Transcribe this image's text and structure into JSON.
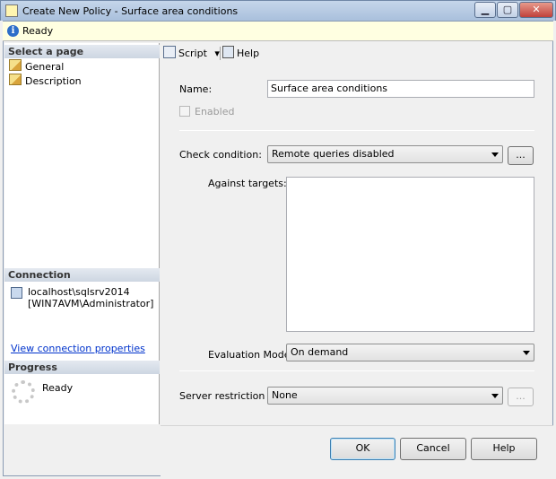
{
  "window": {
    "title": "Create New Policy - Surface area conditions",
    "minimize_glyph": "▁",
    "maximize_glyph": "▢",
    "close_glyph": "✕"
  },
  "status": {
    "text": "Ready",
    "icon": "info-icon",
    "icon_glyph": "i"
  },
  "sidebar": {
    "select_page_header": "Select a page",
    "pages": [
      {
        "label": "General",
        "icon": "page-icon"
      },
      {
        "label": "Description",
        "icon": "page-icon"
      }
    ],
    "connection_header": "Connection",
    "server": "localhost\\sqlsrv2014",
    "user": "[WIN7AVM\\Administrator]",
    "view_connection_link": "View connection properties",
    "progress_header": "Progress",
    "progress_status": "Ready"
  },
  "toolbar": {
    "script_label": "Script",
    "script_dropdown_glyph": "▾",
    "help_label": "Help"
  },
  "form": {
    "name_label": "Name:",
    "name_value": "Surface area conditions",
    "enabled_label": "Enabled",
    "check_condition_label": "Check condition:",
    "check_condition_value": "Remote queries disabled",
    "ellipsis_label": "...",
    "against_targets_label": "Against targets:",
    "evaluation_mode_label": "Evaluation Mode:",
    "evaluation_mode_value": "On demand",
    "server_restriction_label": "Server restriction",
    "server_restriction_value": "None"
  },
  "buttons": {
    "ok": "OK",
    "cancel": "Cancel",
    "help": "Help"
  }
}
